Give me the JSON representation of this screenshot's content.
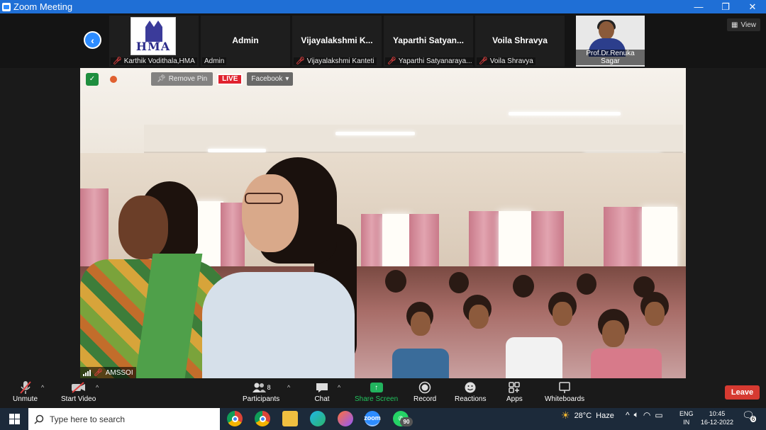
{
  "window": {
    "title": "Zoom Meeting",
    "minimize": "—",
    "restore": "❐",
    "close": "✕"
  },
  "top_bar": {
    "view_label": "View",
    "back_symbol": "‹",
    "logo_text": "HMA",
    "tiles": [
      {
        "big": "",
        "name": "Karthik Vodithala,HMA"
      },
      {
        "big": "Admin",
        "name": "Admin"
      },
      {
        "big": "Vijayalakshmi K...",
        "name": "Vijayalakshmi Kanteti"
      },
      {
        "big": "Yaparthi Satyan...",
        "name": "Yaparthi Satyanaraya..."
      },
      {
        "big": "Voila Shravya",
        "name": "Voila Shravya"
      },
      {
        "big": "",
        "name": "Prof.Dr.Renuka Sagar"
      }
    ]
  },
  "video": {
    "remove_pin_label": "Remove Pin",
    "live_label": "LIVE",
    "stream_target": "Facebook",
    "speaker_name": "AMSSOI"
  },
  "toolbar": {
    "unmute": "Unmute",
    "start_video": "Start Video",
    "participants": "Participants",
    "participants_count": "8",
    "chat": "Chat",
    "share_screen": "Share Screen",
    "record": "Record",
    "reactions": "Reactions",
    "apps": "Apps",
    "whiteboards": "Whiteboards",
    "leave": "Leave",
    "colors": {
      "share": "#22c35e",
      "leave": "#d63a31",
      "accent": "#2d8cff"
    }
  },
  "taskbar": {
    "search_placeholder": "Type here to search",
    "whatsapp_badge": "90",
    "zoom_label": "zoom",
    "temperature": "28°C",
    "weather": "Haze",
    "language_top": "ENG",
    "language_bottom": "IN",
    "time": "10:45",
    "date": "16-12-2022",
    "notification_count": "6"
  }
}
